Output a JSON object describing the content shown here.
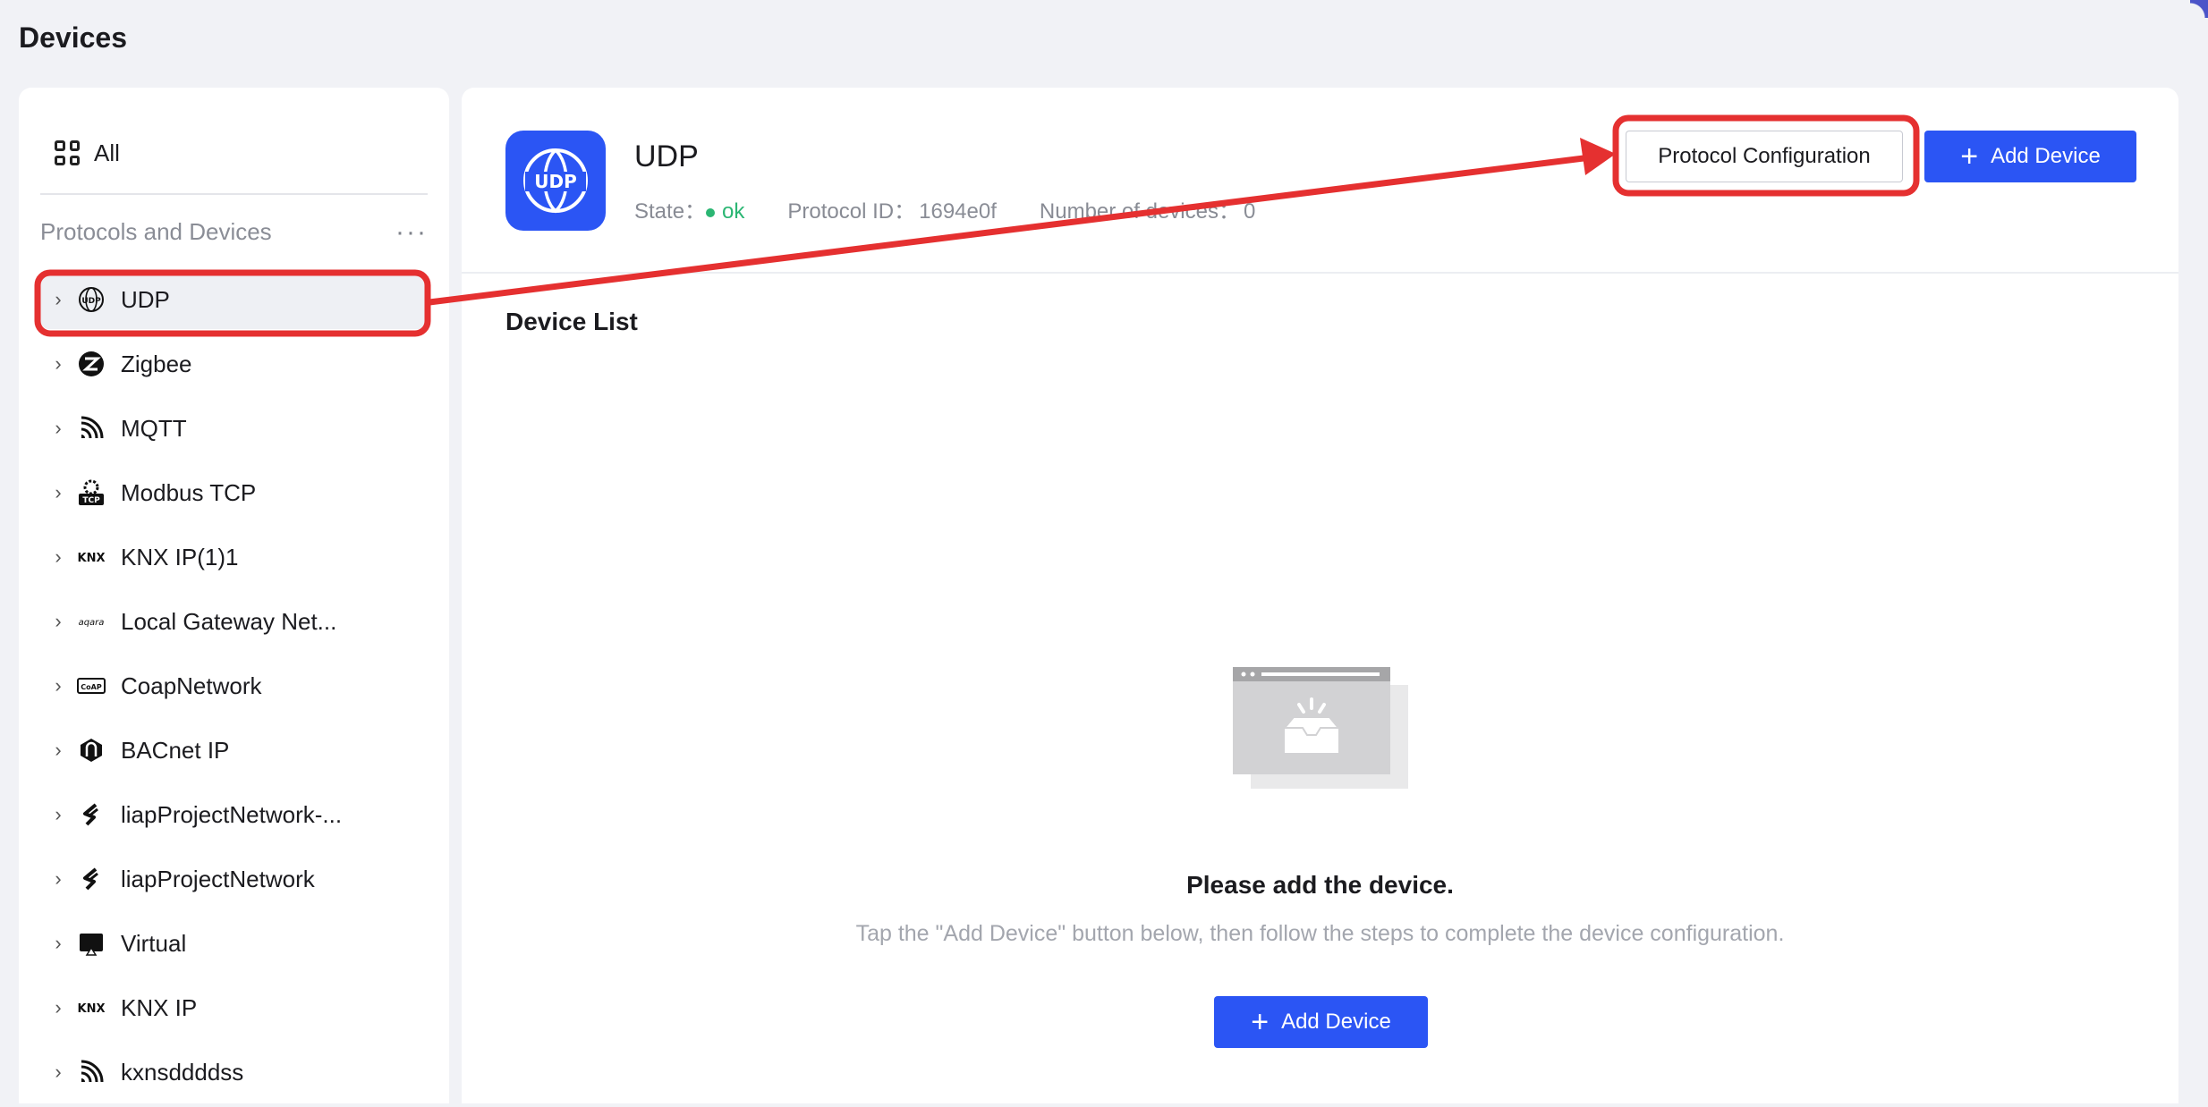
{
  "page": {
    "title": "Devices"
  },
  "sidebar": {
    "all_label": "All",
    "section_title": "Protocols and Devices",
    "more_label": "···",
    "items": [
      {
        "label": "UDP",
        "icon": "udp-globe-icon",
        "active": true
      },
      {
        "label": "Zigbee",
        "icon": "zigbee-icon"
      },
      {
        "label": "MQTT",
        "icon": "mqtt-icon"
      },
      {
        "label": "Modbus TCP",
        "icon": "modbus-tcp-icon"
      },
      {
        "label": "KNX IP(1)1",
        "icon": "knx-icon"
      },
      {
        "label": "Local Gateway Net...",
        "icon": "aqara-icon"
      },
      {
        "label": "CoapNetwork",
        "icon": "coap-icon"
      },
      {
        "label": "BACnet IP",
        "icon": "bacnet-icon"
      },
      {
        "label": "liapProjectNetwork-...",
        "icon": "liap-icon"
      },
      {
        "label": "liapProjectNetwork",
        "icon": "liap-icon"
      },
      {
        "label": "Virtual",
        "icon": "virtual-icon"
      },
      {
        "label": "KNX IP",
        "icon": "knx-icon"
      },
      {
        "label": "kxnsddddss",
        "icon": "mqtt-icon"
      }
    ]
  },
  "main": {
    "protocol_name": "UDP",
    "icon_text": "UDP",
    "state_label": "State：",
    "state_value": "ok",
    "protocol_id_label": "Protocol ID：",
    "protocol_id_value": "1694e0f",
    "device_count_label": "Number of devices：",
    "device_count_value": "0",
    "protocol_config_button": "Protocol Configuration",
    "add_device_button": "Add Device",
    "device_list_title": "Device List",
    "empty_title": "Please add the device.",
    "empty_desc": "Tap the \"Add Device\" button below, then follow the steps to complete the device configuration.",
    "empty_add_button": "Add Device"
  },
  "colors": {
    "primary": "#2b55f4",
    "status_ok": "#2bb673",
    "annotation": "#e53030"
  }
}
